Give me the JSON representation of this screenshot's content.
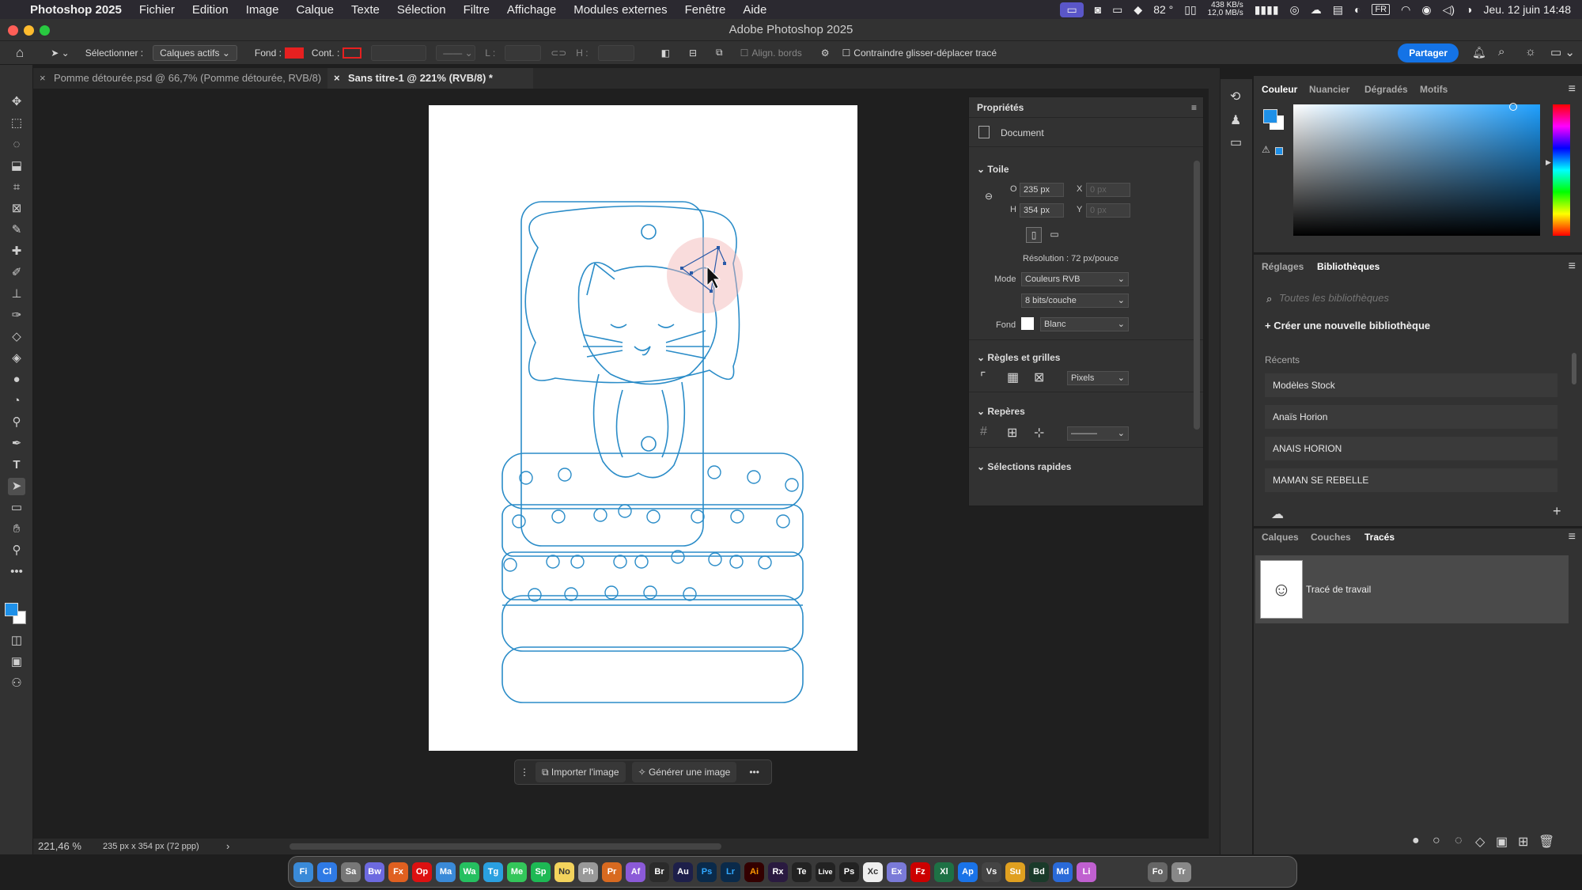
{
  "menubar": {
    "app": "Photoshop 2025",
    "items": [
      "Fichier",
      "Edition",
      "Image",
      "Calque",
      "Texte",
      "Sélection",
      "Filtre",
      "Affichage",
      "Modules externes",
      "Fenêtre",
      "Aide"
    ],
    "battery": "82 °",
    "net_up": "438 KB/s",
    "net_down": "12,0 MB/s",
    "lang": "FR",
    "datetime": "Jeu. 12 juin 14:48"
  },
  "window_title": "Adobe Photoshop 2025",
  "options_bar": {
    "select_label": "Sélectionner :",
    "select_value": "Calques actifs",
    "fill_label": "Fond :",
    "stroke_label": "Cont. :",
    "w_label": "L :",
    "h_label": "H :",
    "align_label": "Align. bords",
    "constrain_label": "Contraindre glisser-déplacer tracé",
    "share": "Partager"
  },
  "tabs": [
    {
      "label": "Pomme détourée.psd @ 66,7% (Pomme détourée, RVB/8)"
    },
    {
      "label": "Sans titre-1 @ 221% (RVB/8) *"
    }
  ],
  "status": {
    "zoom": "221,46 %",
    "info": "235 px x 354 px (72 ppp)",
    "arrow": "›"
  },
  "context_bar": {
    "import": "Importer l'image",
    "generate": "Générer une image",
    "more": "•••"
  },
  "properties": {
    "title": "Propriétés",
    "doc": "Document",
    "canvas_section": "Toile",
    "w_label": "O",
    "w_value": "235 px",
    "h_label": "H",
    "h_value": "354 px",
    "x_label": "X",
    "x_value": "0 px",
    "y_label": "Y",
    "y_value": "0 px",
    "resolution": "Résolution : 72 px/pouce",
    "mode_label": "Mode",
    "mode_value": "Couleurs RVB",
    "depth_value": "8 bits/couche",
    "fill_label": "Fond",
    "fill_value": "Blanc",
    "rulers_section": "Règles et grilles",
    "units_value": "Pixels",
    "guides_section": "Repères",
    "quick_section": "Sélections rapides"
  },
  "color_panel": {
    "tabs": [
      "Couleur",
      "Nuancier",
      "Dégradés",
      "Motifs"
    ],
    "fg_color": "#1e90e8",
    "hue": "#1fa0ff"
  },
  "libraries": {
    "tabs": [
      "Réglages",
      "Bibliothèques"
    ],
    "search_placeholder": "Toutes les bibliothèques",
    "create": "Créer une nouvelle bibliothèque",
    "recent_label": "Récents",
    "items": [
      "Modèles Stock",
      "Anaïs Horion",
      "ANAIS HORION",
      "MAMAN SE REBELLE"
    ]
  },
  "layers": {
    "tabs": [
      "Calques",
      "Couches",
      "Tracés"
    ],
    "path_name": "Tracé de travail"
  },
  "dock": [
    "Fi",
    "Cl",
    "Sa",
    "Bw",
    "Fx",
    "Op",
    "Ma",
    "Wa",
    "Tg",
    "Me",
    "Sp",
    "No",
    "Ph",
    "Pr",
    "Af",
    "Br",
    "Au",
    "Ps",
    "Lr",
    "Ai",
    "Rx",
    "Te",
    "Live",
    "Ps",
    "Xc",
    "Ex",
    "Fz",
    "Xl",
    "Ap",
    "Vs",
    "Su",
    "Bd",
    "Md",
    "Li",
    "Fo",
    "Tr"
  ],
  "colors": {
    "accent": "#1473e6",
    "path": "#2a8cc8",
    "highlight": "#f2b2b2"
  }
}
